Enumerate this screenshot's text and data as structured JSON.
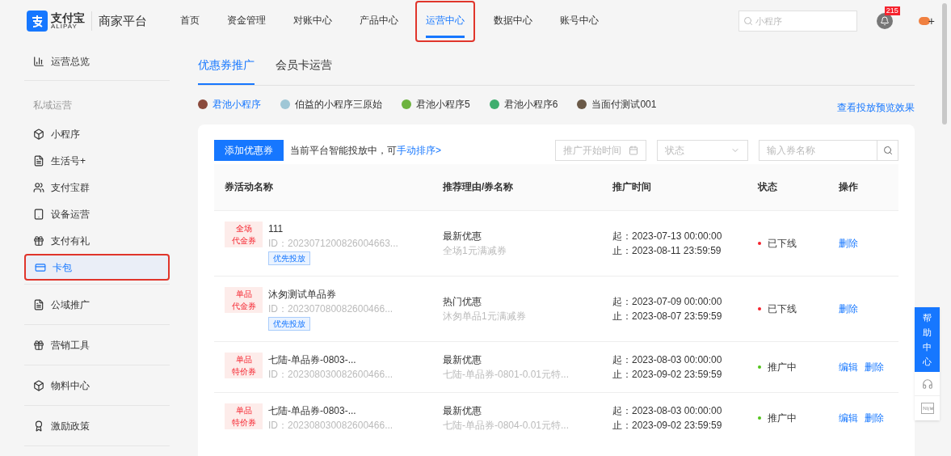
{
  "header": {
    "logo_text": "支付宝",
    "logo_sub": "ALIPAY",
    "platform": "商家平台",
    "nav": [
      {
        "label": "首页",
        "selected": false,
        "highlighted": false
      },
      {
        "label": "资金管理",
        "selected": false,
        "highlighted": false
      },
      {
        "label": "对账中心",
        "selected": false,
        "highlighted": false
      },
      {
        "label": "产品中心",
        "selected": false,
        "highlighted": false
      },
      {
        "label": "运营中心",
        "selected": true,
        "highlighted": true
      },
      {
        "label": "数据中心",
        "selected": false,
        "highlighted": false
      },
      {
        "label": "账号中心",
        "selected": false,
        "highlighted": false
      }
    ],
    "search": {
      "placeholder": "小程序"
    },
    "notification_count": "215",
    "user_mark": "+"
  },
  "sidebar": {
    "top": {
      "label": "运营总览"
    },
    "section": "私域运营",
    "items": [
      {
        "label": "小程序",
        "selected": false,
        "highlighted": false
      },
      {
        "label": "生活号+",
        "selected": false,
        "highlighted": false
      },
      {
        "label": "支付宝群",
        "selected": false,
        "highlighted": false
      },
      {
        "label": "设备运营",
        "selected": false,
        "highlighted": false
      },
      {
        "label": "支付有礼",
        "selected": false,
        "highlighted": false
      },
      {
        "label": "卡包",
        "selected": true,
        "highlighted": true
      }
    ],
    "groups": [
      {
        "label": "公域推广"
      },
      {
        "label": "营销工具"
      },
      {
        "label": "物料中心"
      },
      {
        "label": "激励政策"
      }
    ]
  },
  "tabs": [
    {
      "label": "优惠券推广",
      "selected": true
    },
    {
      "label": "会员卡运营",
      "selected": false
    }
  ],
  "apps": [
    {
      "label": "君池小程序",
      "selected": true,
      "color": "#8b4a3c"
    },
    {
      "label": "伯益的小程序三原始",
      "selected": false,
      "color": "#9fc7d6"
    },
    {
      "label": "君池小程序5",
      "selected": false,
      "color": "#6db33f"
    },
    {
      "label": "君池小程序6",
      "selected": false,
      "color": "#3fae6e"
    },
    {
      "label": "当面付测试001",
      "selected": false,
      "color": "#6b5a48"
    }
  ],
  "preview_link": "查看投放预览效果",
  "toolbar": {
    "add_button": "添加优惠券",
    "hint": "当前平台智能投放中，可",
    "hint_link": "手动排序>",
    "date_placeholder": "推广开始时间",
    "status_placeholder": "状态",
    "name_placeholder": "输入券名称"
  },
  "table": {
    "columns": [
      "券活动名称",
      "推荐理由/券名称",
      "推广时间",
      "状态",
      "操作"
    ],
    "rows": [
      {
        "tag": [
          "全场",
          "代金券"
        ],
        "name": "111",
        "id": "ID：2023071200826004663...",
        "priority": "优先投放",
        "reason": "最新优惠",
        "coupon": "全场1元满减券",
        "start": "起：2023-07-13 00:00:00",
        "end": "止：2023-08-11 23:59:59",
        "status": "已下线",
        "color": "#f5222d",
        "actions": [
          "删除"
        ]
      },
      {
        "tag": [
          "单品",
          "代金券"
        ],
        "name": "沐匆测试单品券",
        "id": "ID：202307080082600466...",
        "priority": "优先投放",
        "reason": "热门优惠",
        "coupon": "沐匆单品1元满减券",
        "start": "起：2023-07-09 00:00:00",
        "end": "止：2023-08-07 23:59:59",
        "status": "已下线",
        "color": "#f5222d",
        "actions": [
          "删除"
        ]
      },
      {
        "tag": [
          "单品",
          "特价券"
        ],
        "name": "七陆-单品券-0803-...",
        "id": "ID：202308030082600466...",
        "reason": "最新优惠",
        "coupon": "七陆-单品券-0801-0.01元特...",
        "start": "起：2023-08-03 00:00:00",
        "end": "止：2023-09-02 23:59:59",
        "status": "推广中",
        "color": "#52c41a",
        "actions": [
          "编辑",
          "删除"
        ]
      },
      {
        "tag": [
          "单品",
          "特价券"
        ],
        "name": "七陆-单品券-0803-...",
        "id": "ID：202308030082600466...",
        "reason": "最新优惠",
        "coupon": "七陆-单品券-0804-0.01元特...",
        "start": "起：2023-08-03 00:00:00",
        "end": "止：2023-09-02 23:59:59",
        "status": "推广中",
        "color": "#52c41a",
        "actions": [
          "编辑",
          "删除"
        ]
      }
    ]
  },
  "help": {
    "label": "帮助中心"
  }
}
